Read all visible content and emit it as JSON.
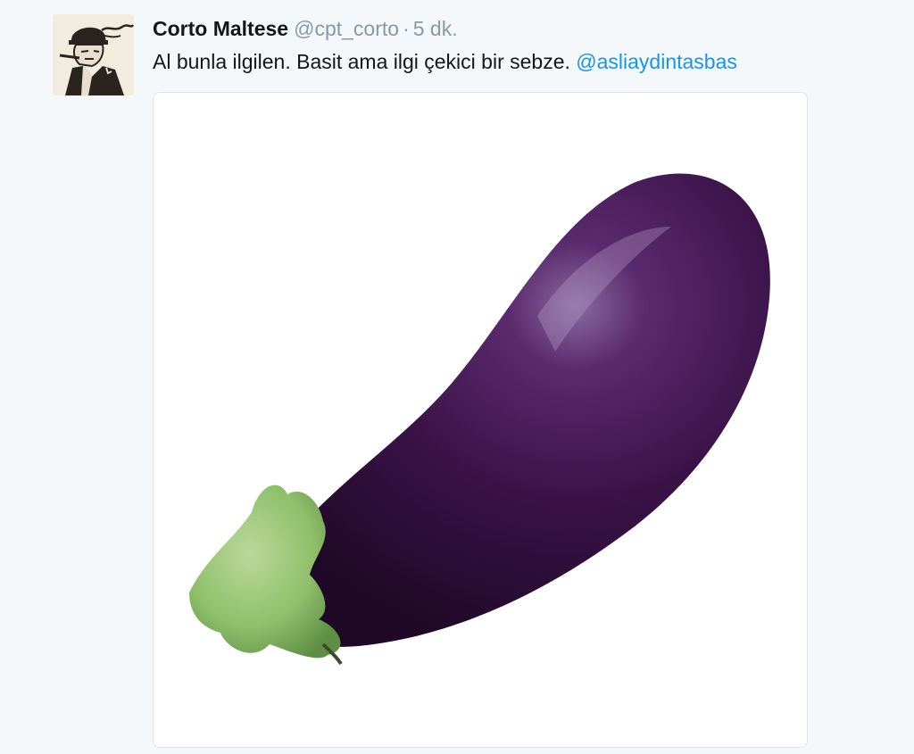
{
  "tweet": {
    "author_name": "Corto Maltese",
    "author_handle": "@cpt_corto",
    "separator": "·",
    "timestamp": "5 dk.",
    "text": "Al bunla ilgilen. Basit ama ilgi çekici bir sebze.",
    "mention": "@asliaydintasbas",
    "avatar_icon": "comic-portrait-icon",
    "media_icon": "eggplant-photo-icon"
  },
  "colors": {
    "background": "#f5f8fa",
    "name": "#14171a",
    "meta": "#8899a6",
    "link": "#1b95e0",
    "eggplant": "#3a1247",
    "stem": "#8fbf6a"
  }
}
